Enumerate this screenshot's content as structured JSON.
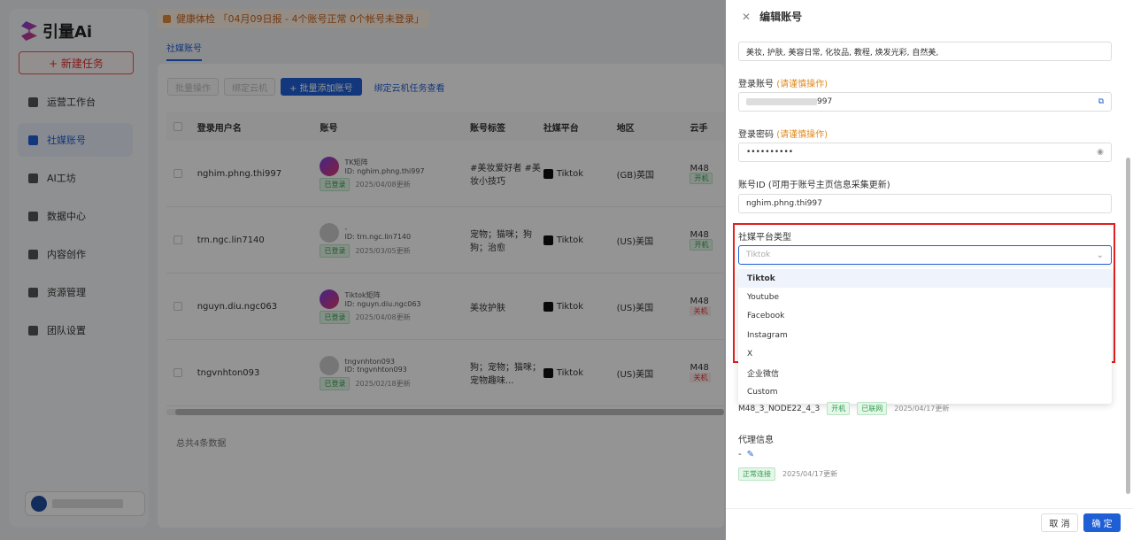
{
  "app": {
    "logo": "引量Ai"
  },
  "sidebar": {
    "new_task": "+ 新建任务",
    "items": [
      {
        "label": "运营工作台",
        "icon": "dashboard-icon"
      },
      {
        "label": "社媒账号",
        "icon": "account-icon",
        "active": true
      },
      {
        "label": "AI工坊",
        "icon": "ai-icon"
      },
      {
        "label": "数据中心",
        "icon": "data-icon"
      },
      {
        "label": "内容创作",
        "icon": "content-icon"
      },
      {
        "label": "资源管理",
        "icon": "resource-icon"
      },
      {
        "label": "团队设置",
        "icon": "team-icon"
      }
    ]
  },
  "main": {
    "notice": "健康体检 「04月09日报 - 4个账号正常 0个帐号未登录」",
    "tab": "社媒账号",
    "toolbar": {
      "batch": "批量操作",
      "bind_cloud": "绑定云机",
      "batch_add": "+ 批量添加账号",
      "view_tasks": "绑定云机任务查看"
    },
    "columns": [
      "登录用户名",
      "账号",
      "账号标签",
      "社媒平台",
      "地区",
      "云手"
    ],
    "rows": [
      {
        "user": "nghim.phng.thi997",
        "name": "TK矩阵",
        "id": "ID: nghim.phng.thi997",
        "status": "已登录",
        "updated": "2025/04/08更新",
        "tag": "#美妆爱好者 #美妆小技巧",
        "platform": "Tiktok",
        "region": "(GB)英国",
        "cloud": "M48",
        "cloud_status": "开机"
      },
      {
        "user": "trn.ngc.lin7140",
        "name": "-",
        "id": "ID: trn.ngc.lin7140",
        "status": "已登录",
        "updated": "2025/03/05更新",
        "tag": "宠物；猫咪；狗狗；治愈",
        "platform": "Tiktok",
        "region": "(US)美国",
        "cloud": "M48",
        "cloud_status": "开机"
      },
      {
        "user": "nguyn.diu.ngc063",
        "name": "Tiktok矩阵",
        "id": "ID: nguyn.diu.ngc063",
        "status": "已登录",
        "updated": "2025/04/08更新",
        "tag": "美妆护肤",
        "platform": "Tiktok",
        "region": "(US)美国",
        "cloud": "M48",
        "cloud_status": "关机"
      },
      {
        "user": "tngvnhton093",
        "name": "tngvnhton093",
        "id": "ID: tngvnhton093",
        "status": "已登录",
        "updated": "2025/02/18更新",
        "tag": "狗；宠物；猫咪；宠物趣味...",
        "platform": "Tiktok",
        "region": "(US)美国",
        "cloud": "M48",
        "cloud_status": "关机"
      }
    ],
    "total": "总共4条数据"
  },
  "drawer": {
    "title": "编辑账号",
    "keywords_value": "美妆, 护肤, 美容日常, 化妆品, 教程, 焕发光彩, 自然美,",
    "login_label": "登录账号",
    "login_warn": "(请谨慎操作)",
    "login_value_suffix": "997",
    "password_label": "登录密码",
    "password_warn": "(请谨慎操作)",
    "password_value": "••••••••••",
    "account_id_label": "账号ID (可用于账号主页信息采集更新)",
    "account_id_value": "nghim.phng.thi997",
    "platform_label": "社媒平台类型",
    "platform_placeholder": "Tiktok",
    "options": [
      "Tiktok",
      "Youtube",
      "Facebook",
      "Instagram",
      "X",
      "企业微信",
      "Custom"
    ],
    "cloud_node": "M48_3_NODE22_4_3",
    "cloud_power": "开机",
    "cloud_net": "已联网",
    "cloud_updated": "2025/04/17更新",
    "proxy_label": "代理信息",
    "proxy_value": "-",
    "proxy_status": "正常连接",
    "proxy_updated": "2025/04/17更新",
    "cancel": "取 消",
    "ok": "确 定"
  }
}
